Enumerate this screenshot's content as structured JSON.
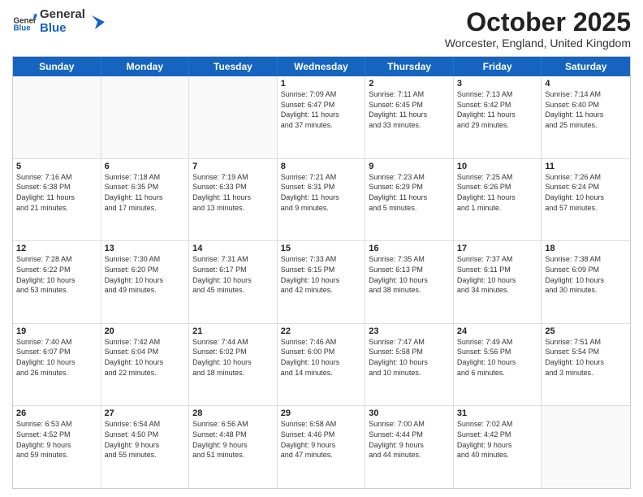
{
  "header": {
    "logo_general": "General",
    "logo_blue": "Blue",
    "month_title": "October 2025",
    "location": "Worcester, England, United Kingdom"
  },
  "day_headers": [
    "Sunday",
    "Monday",
    "Tuesday",
    "Wednesday",
    "Thursday",
    "Friday",
    "Saturday"
  ],
  "weeks": [
    [
      {
        "day": "",
        "empty": true,
        "info": ""
      },
      {
        "day": "",
        "empty": true,
        "info": ""
      },
      {
        "day": "",
        "empty": true,
        "info": ""
      },
      {
        "day": "1",
        "empty": false,
        "info": "Sunrise: 7:09 AM\nSunset: 6:47 PM\nDaylight: 11 hours\nand 37 minutes."
      },
      {
        "day": "2",
        "empty": false,
        "info": "Sunrise: 7:11 AM\nSunset: 6:45 PM\nDaylight: 11 hours\nand 33 minutes."
      },
      {
        "day": "3",
        "empty": false,
        "info": "Sunrise: 7:13 AM\nSunset: 6:42 PM\nDaylight: 11 hours\nand 29 minutes."
      },
      {
        "day": "4",
        "empty": false,
        "info": "Sunrise: 7:14 AM\nSunset: 6:40 PM\nDaylight: 11 hours\nand 25 minutes."
      }
    ],
    [
      {
        "day": "5",
        "empty": false,
        "info": "Sunrise: 7:16 AM\nSunset: 6:38 PM\nDaylight: 11 hours\nand 21 minutes."
      },
      {
        "day": "6",
        "empty": false,
        "info": "Sunrise: 7:18 AM\nSunset: 6:35 PM\nDaylight: 11 hours\nand 17 minutes."
      },
      {
        "day": "7",
        "empty": false,
        "info": "Sunrise: 7:19 AM\nSunset: 6:33 PM\nDaylight: 11 hours\nand 13 minutes."
      },
      {
        "day": "8",
        "empty": false,
        "info": "Sunrise: 7:21 AM\nSunset: 6:31 PM\nDaylight: 11 hours\nand 9 minutes."
      },
      {
        "day": "9",
        "empty": false,
        "info": "Sunrise: 7:23 AM\nSunset: 6:29 PM\nDaylight: 11 hours\nand 5 minutes."
      },
      {
        "day": "10",
        "empty": false,
        "info": "Sunrise: 7:25 AM\nSunset: 6:26 PM\nDaylight: 11 hours\nand 1 minute."
      },
      {
        "day": "11",
        "empty": false,
        "info": "Sunrise: 7:26 AM\nSunset: 6:24 PM\nDaylight: 10 hours\nand 57 minutes."
      }
    ],
    [
      {
        "day": "12",
        "empty": false,
        "info": "Sunrise: 7:28 AM\nSunset: 6:22 PM\nDaylight: 10 hours\nand 53 minutes."
      },
      {
        "day": "13",
        "empty": false,
        "info": "Sunrise: 7:30 AM\nSunset: 6:20 PM\nDaylight: 10 hours\nand 49 minutes."
      },
      {
        "day": "14",
        "empty": false,
        "info": "Sunrise: 7:31 AM\nSunset: 6:17 PM\nDaylight: 10 hours\nand 45 minutes."
      },
      {
        "day": "15",
        "empty": false,
        "info": "Sunrise: 7:33 AM\nSunset: 6:15 PM\nDaylight: 10 hours\nand 42 minutes."
      },
      {
        "day": "16",
        "empty": false,
        "info": "Sunrise: 7:35 AM\nSunset: 6:13 PM\nDaylight: 10 hours\nand 38 minutes."
      },
      {
        "day": "17",
        "empty": false,
        "info": "Sunrise: 7:37 AM\nSunset: 6:11 PM\nDaylight: 10 hours\nand 34 minutes."
      },
      {
        "day": "18",
        "empty": false,
        "info": "Sunrise: 7:38 AM\nSunset: 6:09 PM\nDaylight: 10 hours\nand 30 minutes."
      }
    ],
    [
      {
        "day": "19",
        "empty": false,
        "info": "Sunrise: 7:40 AM\nSunset: 6:07 PM\nDaylight: 10 hours\nand 26 minutes."
      },
      {
        "day": "20",
        "empty": false,
        "info": "Sunrise: 7:42 AM\nSunset: 6:04 PM\nDaylight: 10 hours\nand 22 minutes."
      },
      {
        "day": "21",
        "empty": false,
        "info": "Sunrise: 7:44 AM\nSunset: 6:02 PM\nDaylight: 10 hours\nand 18 minutes."
      },
      {
        "day": "22",
        "empty": false,
        "info": "Sunrise: 7:46 AM\nSunset: 6:00 PM\nDaylight: 10 hours\nand 14 minutes."
      },
      {
        "day": "23",
        "empty": false,
        "info": "Sunrise: 7:47 AM\nSunset: 5:58 PM\nDaylight: 10 hours\nand 10 minutes."
      },
      {
        "day": "24",
        "empty": false,
        "info": "Sunrise: 7:49 AM\nSunset: 5:56 PM\nDaylight: 10 hours\nand 6 minutes."
      },
      {
        "day": "25",
        "empty": false,
        "info": "Sunrise: 7:51 AM\nSunset: 5:54 PM\nDaylight: 10 hours\nand 3 minutes."
      }
    ],
    [
      {
        "day": "26",
        "empty": false,
        "info": "Sunrise: 6:53 AM\nSunset: 4:52 PM\nDaylight: 9 hours\nand 59 minutes."
      },
      {
        "day": "27",
        "empty": false,
        "info": "Sunrise: 6:54 AM\nSunset: 4:50 PM\nDaylight: 9 hours\nand 55 minutes."
      },
      {
        "day": "28",
        "empty": false,
        "info": "Sunrise: 6:56 AM\nSunset: 4:48 PM\nDaylight: 9 hours\nand 51 minutes."
      },
      {
        "day": "29",
        "empty": false,
        "info": "Sunrise: 6:58 AM\nSunset: 4:46 PM\nDaylight: 9 hours\nand 47 minutes."
      },
      {
        "day": "30",
        "empty": false,
        "info": "Sunrise: 7:00 AM\nSunset: 4:44 PM\nDaylight: 9 hours\nand 44 minutes."
      },
      {
        "day": "31",
        "empty": false,
        "info": "Sunrise: 7:02 AM\nSunset: 4:42 PM\nDaylight: 9 hours\nand 40 minutes."
      },
      {
        "day": "",
        "empty": true,
        "info": ""
      }
    ]
  ]
}
